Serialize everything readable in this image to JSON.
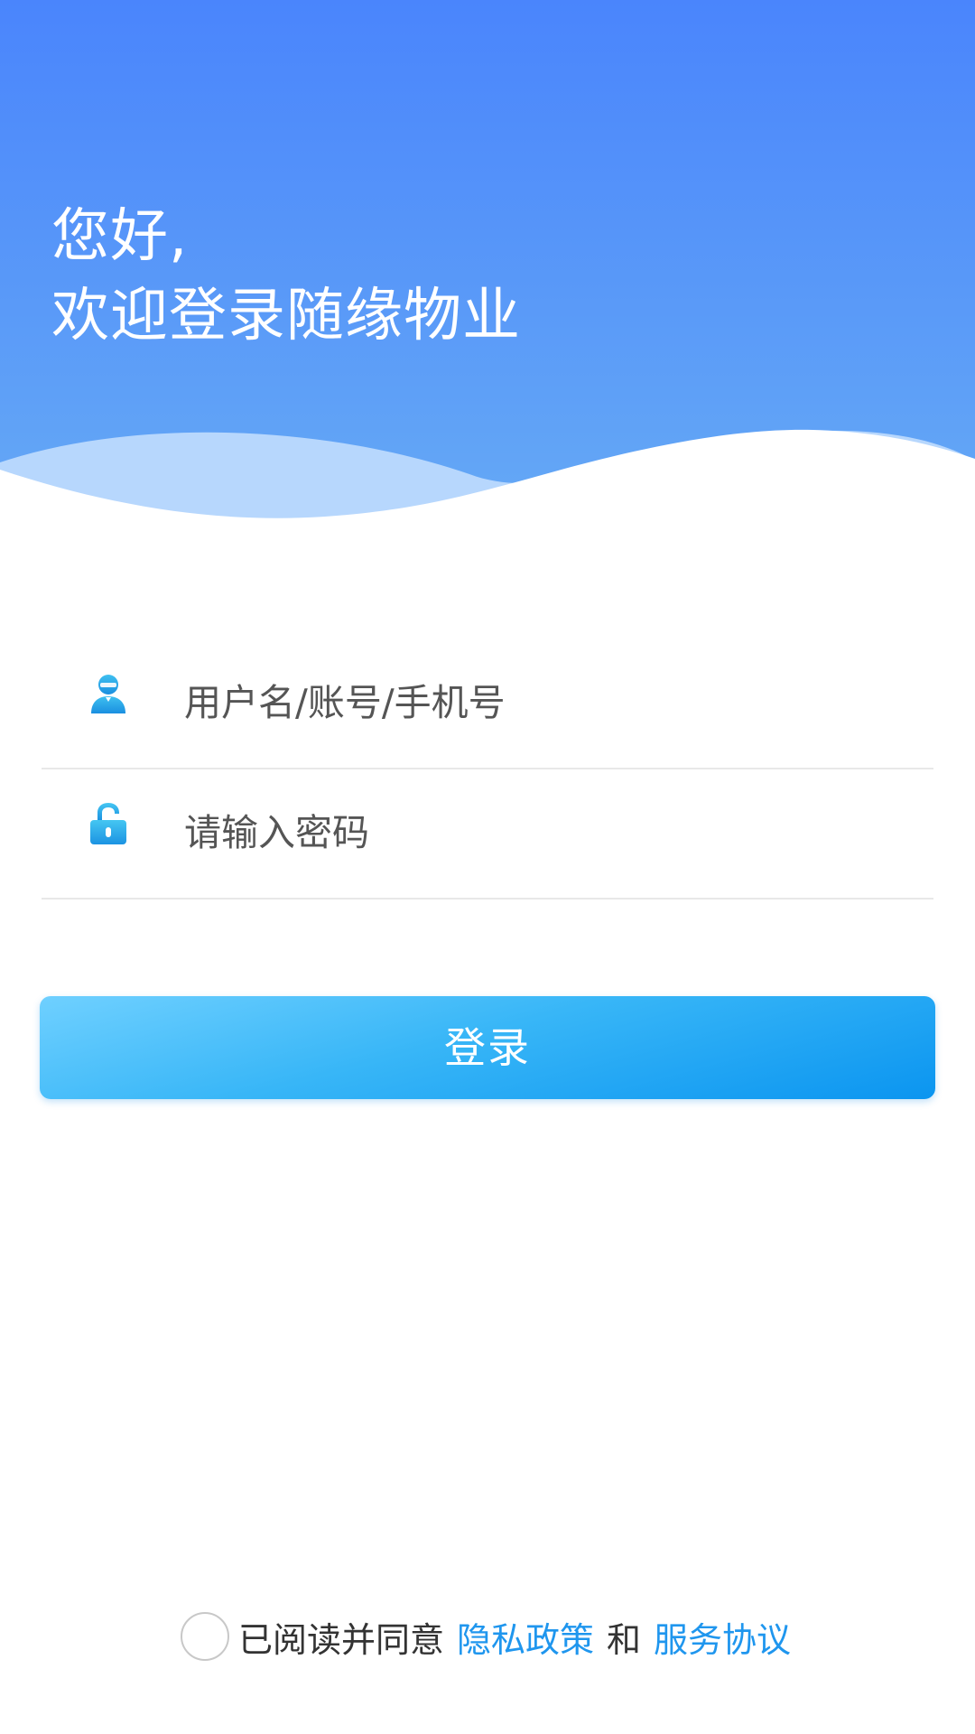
{
  "header": {
    "greeting_line1": "您好,",
    "greeting_line2": "欢迎登录随缘物业"
  },
  "form": {
    "username_placeholder": "用户名/账号/手机号",
    "password_placeholder": "请输入密码",
    "username_icon": "user-icon",
    "password_icon": "unlock-icon",
    "login_label": "登录"
  },
  "agreement": {
    "prefix": "已阅读并同意",
    "privacy_link": "隐私政策",
    "and": "和",
    "service_link": "服务协议"
  },
  "colors": {
    "header_top": "#4a87fb",
    "header_bottom": "#62a8f6",
    "accent": "#1f96ee",
    "button_light": "#6fd0ff",
    "button_dark": "#0b95f0"
  }
}
